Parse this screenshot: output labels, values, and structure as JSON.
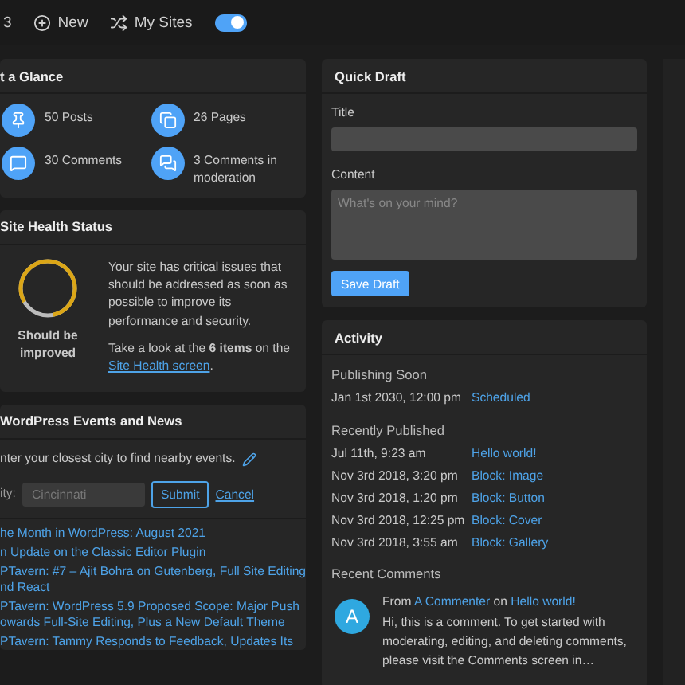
{
  "top_bar": {
    "count": "3",
    "new_label": "New",
    "my_sites_label": "My Sites",
    "toggle_on": true
  },
  "at_a_glance": {
    "title": "t a Glance",
    "items": [
      {
        "kind": "posts",
        "label": "50 Posts"
      },
      {
        "kind": "pages",
        "label": "26 Pages"
      },
      {
        "kind": "comments",
        "label": "30 Comments"
      },
      {
        "kind": "moderation",
        "label": "3 Comments in moderation"
      }
    ]
  },
  "site_health": {
    "title": "Site Health Status",
    "status": "Should be improved",
    "description": "Your site has critical issues that should be addressed as soon as possible to improve its performance and security.",
    "take_look": "Take a look at the **6 items** on the",
    "link": "Site Health screen",
    "period": "."
  },
  "events": {
    "title": "WordPress Events and News",
    "intro": "nter your closest city to find nearby events.",
    "city_label": "ity:",
    "city_value": "Cincinnati",
    "submit": "Submit",
    "cancel": "Cancel",
    "news": [
      "he Month in WordPress: August 2021",
      "n Update on the Classic Editor Plugin",
      "PTavern: #7 – Ajit Bohra on Gutenberg, Full Site Editing nd React",
      "PTavern: WordPress 5.9 Proposed Scope: Major Push owards Full-Site Editing, Plus a New Default Theme",
      "PTavern: Tammy Responds to Feedback, Updates Its"
    ]
  },
  "quick_draft": {
    "title": "Quick Draft",
    "title_label": "Title",
    "content_label": "Content",
    "content_placeholder": "What's on your mind?",
    "save": "Save Draft"
  },
  "activity": {
    "title": "Activity",
    "publishing_soon": "Publishing Soon",
    "scheduled": [
      {
        "date": "Jan 1st 2030, 12:00 pm",
        "link": "Scheduled"
      }
    ],
    "recently_published": "Recently Published",
    "published": [
      {
        "date": "Jul 11th, 9:23 am",
        "link": "Hello world!"
      },
      {
        "date": "Nov 3rd 2018, 3:20 pm",
        "link": "Block: Image"
      },
      {
        "date": "Nov 3rd 2018, 1:20 pm",
        "link": "Block: Button"
      },
      {
        "date": "Nov 3rd 2018, 12:25 pm",
        "link": "Block: Cover"
      },
      {
        "date": "Nov 3rd 2018, 3:55 am",
        "link": "Block: Gallery"
      }
    ],
    "recent_comments": "Recent Comments",
    "comment": {
      "avatar_letter": "A",
      "from": "From",
      "author": "A Commenter",
      "on": "on",
      "post": "Hello world!",
      "text": "Hi, this is a comment. To get started with moderating, editing, and deleting comments, please visit the Comments screen in…"
    }
  }
}
